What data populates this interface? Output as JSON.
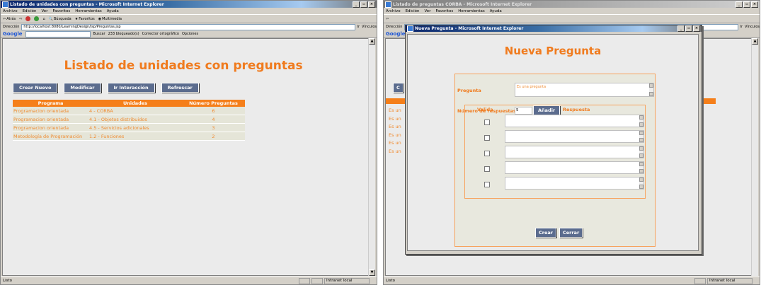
{
  "left_window": {
    "title": "Listado de unidades con preguntas - Microsoft Internet Explorer",
    "menu": [
      "Archivo",
      "Edición",
      "Ver",
      "Favoritos",
      "Herramientas",
      "Ayuda"
    ],
    "toolbar": [
      "Atrás",
      "Búsqueda",
      "Favoritos",
      "Multimedia"
    ],
    "address_label": "Dirección",
    "address_value": "http://localhost:8080/LearningDesign/jsp/Preguntas.jsp",
    "go_label": "Ir",
    "links_label": "Vínculos",
    "google": {
      "logo": "Google",
      "search": "Buscar",
      "blocked": "233 bloqueado(s)",
      "spell": "Corrector ortográfico",
      "options": "Opciones"
    },
    "page_title": "Listado de unidades con preguntas",
    "buttons": [
      "Crear Nuevo",
      "Modificar",
      "Ir Interacción",
      "Refrescar"
    ],
    "table": {
      "headers": [
        "Programa",
        "Unidades",
        "Número Preguntas"
      ],
      "rows": [
        [
          "Programacion orientada",
          "4 - CORBA",
          "6"
        ],
        [
          "Programacion orientada",
          "4.1 - Objetos distribuidos",
          "4"
        ],
        [
          "Programacion orientada",
          "4.5 - Servicios adicionales",
          "3"
        ],
        [
          "Metodología de Programación",
          "1.2 - Funciones",
          "2"
        ]
      ]
    },
    "status_left": "Listo",
    "status_zone": "Intranet local"
  },
  "right_window": {
    "title": "Listado de preguntas CORBA - Microsoft Internet Explorer",
    "menu": [
      "Archivo",
      "Edición",
      "Ver",
      "Favoritos",
      "Herramientas",
      "Ayuda"
    ],
    "address_label": "Dirección",
    "go_label": "Ir",
    "links_label": "Vínculos",
    "google_logo": "Google",
    "bg_button": "C",
    "bg_rows": [
      "Es un",
      "Es un",
      "Es un",
      "Es un",
      "Es un",
      "Es un"
    ],
    "status_left": "Listo",
    "status_zone": "Intranet local"
  },
  "modal": {
    "title": "Nueva Pregunta - Microsoft Internet Explorer",
    "heading": "Nueva Pregunta",
    "pregunta_label": "Pregunta",
    "pregunta_value": "Es una pregunta",
    "num_resp_label": "Número de respuestas",
    "num_resp_value": "5",
    "add_button": "Añadir",
    "col_valida": "Valida",
    "col_respuesta": "Respuesta",
    "crear": "Crear",
    "cerrar": "Cerrar"
  },
  "colors": {
    "accent": "#f07b1e",
    "button": "#5b6c8e",
    "title_active": "#0a246a"
  }
}
